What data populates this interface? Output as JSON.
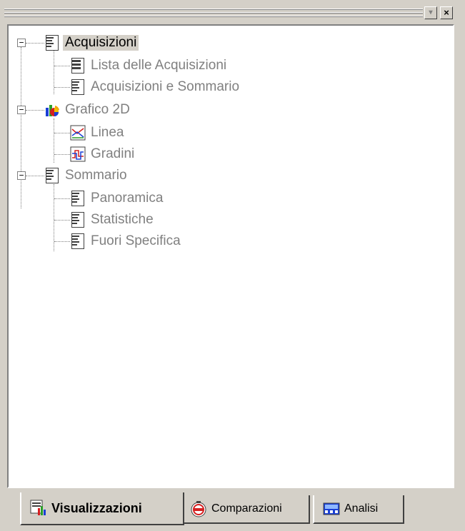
{
  "window": {
    "menu_glyph": "▾",
    "close_glyph": "×"
  },
  "tree": [
    {
      "label": "Acquisizioni",
      "icon": "report-icon",
      "level": 0,
      "expanded": true,
      "selected": true
    },
    {
      "label": "Lista delle Acquisizioni",
      "icon": "table-icon",
      "level": 1
    },
    {
      "label": "Acquisizioni e Sommario",
      "icon": "report-icon",
      "level": 1
    },
    {
      "label": "Grafico 2D",
      "icon": "chart-icon",
      "level": 0,
      "expanded": true
    },
    {
      "label": "Linea",
      "icon": "line-chart-icon",
      "level": 1
    },
    {
      "label": "Gradini",
      "icon": "step-chart-icon",
      "level": 1
    },
    {
      "label": "Sommario",
      "icon": "report-icon",
      "level": 0,
      "expanded": true
    },
    {
      "label": "Panoramica",
      "icon": "report-icon",
      "level": 1
    },
    {
      "label": "Statistiche",
      "icon": "report-icon",
      "level": 1
    },
    {
      "label": "Fuori Specifica",
      "icon": "report-icon",
      "level": 1
    }
  ],
  "tabs": [
    {
      "label": "Visualizzazioni",
      "icon": "visualizations-icon",
      "active": true
    },
    {
      "label": "Comparazioni",
      "icon": "compare-icon",
      "active": false
    },
    {
      "label": "Analisi",
      "icon": "analysis-icon",
      "active": false
    }
  ],
  "colors": {
    "window_bg": "#d4d0c8",
    "panel_bg": "#ffffff",
    "text_inactive": "#808080",
    "text_active": "#000000"
  }
}
